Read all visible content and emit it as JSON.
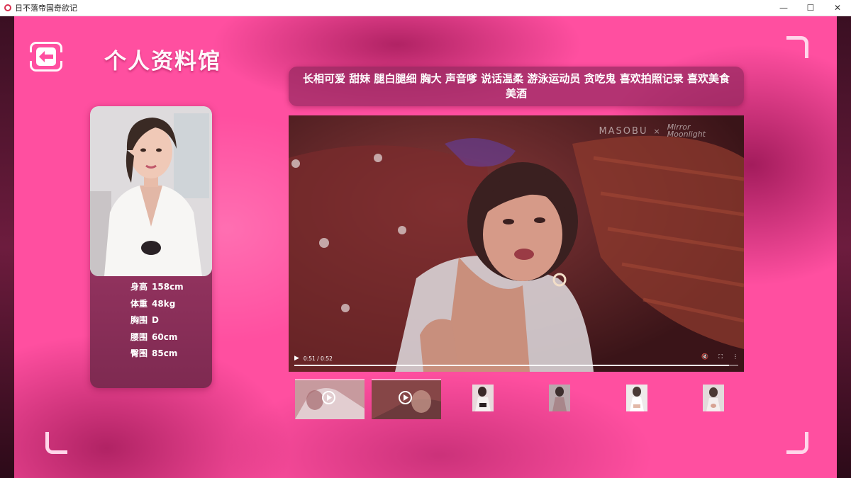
{
  "window": {
    "title": "日不落帝国奇欲记"
  },
  "page": {
    "title": "个人资料馆"
  },
  "tags": "长相可爱 甜妹 腿白腿细 胸大 声音嗲 说话温柔 游泳运动员 贪吃鬼 喜欢拍照记录 喜欢美食美酒",
  "stats": [
    {
      "label": "身高",
      "value": "158cm"
    },
    {
      "label": "体重",
      "value": "48kg"
    },
    {
      "label": "胸围",
      "value": "D"
    },
    {
      "label": "腰围",
      "value": "60cm"
    },
    {
      "label": "臀围",
      "value": "85cm"
    }
  ],
  "video": {
    "time": "0:51 / 0:52",
    "progress": 0.98,
    "watermark_left": "MASOBU",
    "watermark_sep": "×",
    "watermark_right_top": "Mirror",
    "watermark_right_bottom": "Moonlight"
  },
  "icons": {
    "back": "back-arrow-icon",
    "play": "play-icon",
    "mute": "mute-icon",
    "fullscreen": "fullscreen-icon",
    "more": "more-icon"
  },
  "colors": {
    "background": "#ff4fa0",
    "card": "#93335f",
    "accent": "#ffd6ea"
  }
}
